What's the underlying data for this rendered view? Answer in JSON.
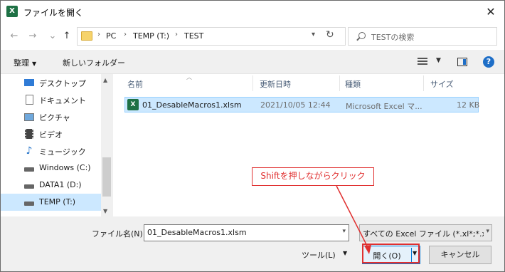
{
  "window": {
    "title": "ファイルを開く",
    "app_icon_text": "X",
    "close_symbol": "✕"
  },
  "nav": {
    "back": "←",
    "forward": "→",
    "recent": "⌄",
    "up": "↑",
    "crumbs": [
      "PC",
      "TEMP (T:)",
      "TEST"
    ],
    "crumb_sep": "›",
    "refresh": "↻",
    "search_placeholder": "TESTの検索"
  },
  "toolbar": {
    "organize": "整理",
    "new_folder": "新しいフォルダー",
    "help": "?"
  },
  "sidebar": {
    "items": [
      {
        "label": "デスクトップ",
        "icon": "desktop-icon"
      },
      {
        "label": "ドキュメント",
        "icon": "document-icon"
      },
      {
        "label": "ピクチャ",
        "icon": "pictures-icon"
      },
      {
        "label": "ビデオ",
        "icon": "video-icon"
      },
      {
        "label": "ミュージック",
        "icon": "music-icon"
      },
      {
        "label": "Windows (C:)",
        "icon": "drive-icon"
      },
      {
        "label": "DATA1 (D:)",
        "icon": "drive-icon"
      },
      {
        "label": "TEMP (T:)",
        "icon": "drive-icon",
        "selected": true
      }
    ]
  },
  "filelist": {
    "columns": [
      "名前",
      "更新日時",
      "種類",
      "サイズ"
    ],
    "rows": [
      {
        "name": "01_DesableMacros1.xlsm",
        "modified": "2021/10/05 12:44",
        "type": "Microsoft Excel マ...",
        "size": "12 KB"
      }
    ]
  },
  "bottom": {
    "filename_label": "ファイル名(N):",
    "filename_value": "01_DesableMacros1.xlsm",
    "filetype": "すべての Excel ファイル (*.xl*;*.xlsx",
    "tools_label": "ツール(L)",
    "open_label": "開く(O)",
    "cancel_label": "キャンセル"
  },
  "annotation": {
    "text": "Shiftを押しながらクリック",
    "color": "#e03030"
  }
}
